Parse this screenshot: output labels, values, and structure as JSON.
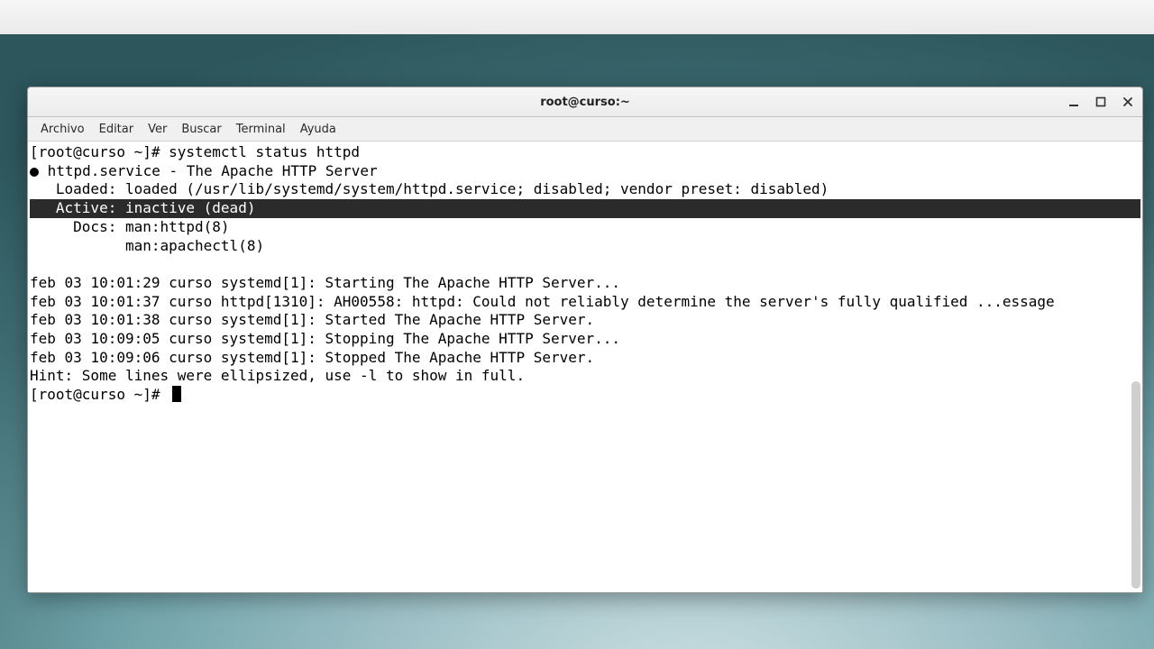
{
  "crop_fragment": "da",
  "window": {
    "title": "root@curso:~",
    "controls": {
      "minimize": "minimize",
      "maximize": "maximize",
      "close": "close"
    }
  },
  "menu": {
    "archivo": "Archivo",
    "editar": "Editar",
    "ver": "Ver",
    "buscar": "Buscar",
    "terminal": "Terminal",
    "ayuda": "Ayuda"
  },
  "terminal": {
    "prompt1": "[root@curso ~]# ",
    "cmd1": "systemctl status httpd",
    "service_header": " httpd.service - The Apache HTTP Server",
    "loaded": "   Loaded: loaded (/usr/lib/systemd/system/httpd.service; disabled; vendor preset: disabled)",
    "active": "   Active: inactive (dead)",
    "docs1": "     Docs: man:httpd(8)",
    "docs2": "           man:apachectl(8)",
    "log1": "feb 03 10:01:29 curso systemd[1]: Starting The Apache HTTP Server...",
    "log2": "feb 03 10:01:37 curso httpd[1310]: AH00558: httpd: Could not reliably determine the server's fully qualified ...essage",
    "log3": "feb 03 10:01:38 curso systemd[1]: Started The Apache HTTP Server.",
    "log4": "feb 03 10:09:05 curso systemd[1]: Stopping The Apache HTTP Server...",
    "log5": "feb 03 10:09:06 curso systemd[1]: Stopped The Apache HTTP Server.",
    "hint": "Hint: Some lines were ellipsized, use -l to show in full.",
    "prompt2": "[root@curso ~]# "
  }
}
